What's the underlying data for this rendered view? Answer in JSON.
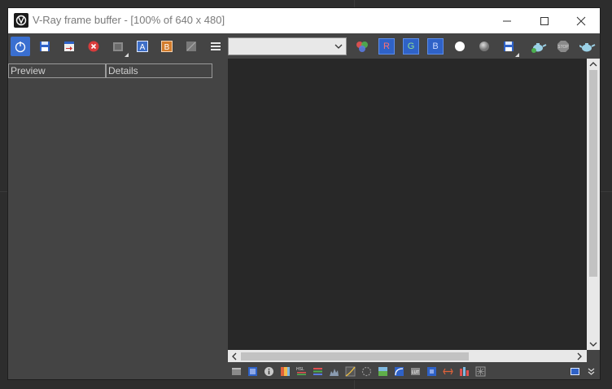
{
  "window": {
    "title": "V-Ray frame buffer - [100% of 640 x 480]",
    "icon": "vray-logo-icon"
  },
  "window_controls": [
    "minimize-icon",
    "maximize-icon",
    "close-icon"
  ],
  "toolbar": {
    "buttons": [
      {
        "name": "power-toggle",
        "icon": "power-icon",
        "active": true
      },
      {
        "name": "save-image",
        "icon": "save-icon"
      },
      {
        "name": "load-image",
        "icon": "load-icon"
      },
      {
        "name": "clear-image",
        "icon": "clear-icon"
      },
      {
        "name": "history",
        "icon": "history-icon"
      },
      {
        "name": "compare-a",
        "icon": "a-icon"
      },
      {
        "name": "compare-b",
        "icon": "b-icon"
      },
      {
        "name": "compare-split",
        "icon": "split-icon"
      },
      {
        "name": "menu",
        "icon": "menu-icon"
      }
    ],
    "channel_select": {
      "value": ""
    },
    "channels": [
      "R",
      "G",
      "B"
    ],
    "right_buttons": [
      {
        "name": "rgb-channels",
        "icon": "rgb-circles-icon"
      },
      {
        "name": "white-dot",
        "icon": "white-circle-icon"
      },
      {
        "name": "gray-dot",
        "icon": "gray-circle-icon"
      },
      {
        "name": "save-all",
        "icon": "save-icon"
      },
      {
        "name": "render-interactive",
        "icon": "teapot-icon"
      },
      {
        "name": "stop-render",
        "icon": "stop-icon"
      },
      {
        "name": "render",
        "icon": "teapot-icon"
      }
    ]
  },
  "left_panel": {
    "tabs": [
      "Preview",
      "Details"
    ]
  },
  "bottom_bar": {
    "icons": [
      "panel-icon",
      "layers-icon",
      "info-icon",
      "color-corrections-icon",
      "hsl-icon",
      "levels-icon",
      "histogram-icon",
      "curves-icon",
      "exposure-icon",
      "background-icon",
      "lens-icon",
      "lut-icon",
      "ocio-icon",
      "lens-effects-icon",
      "stereo-icon",
      "lightmix-icon",
      "region-icon",
      "expand-icon"
    ]
  }
}
